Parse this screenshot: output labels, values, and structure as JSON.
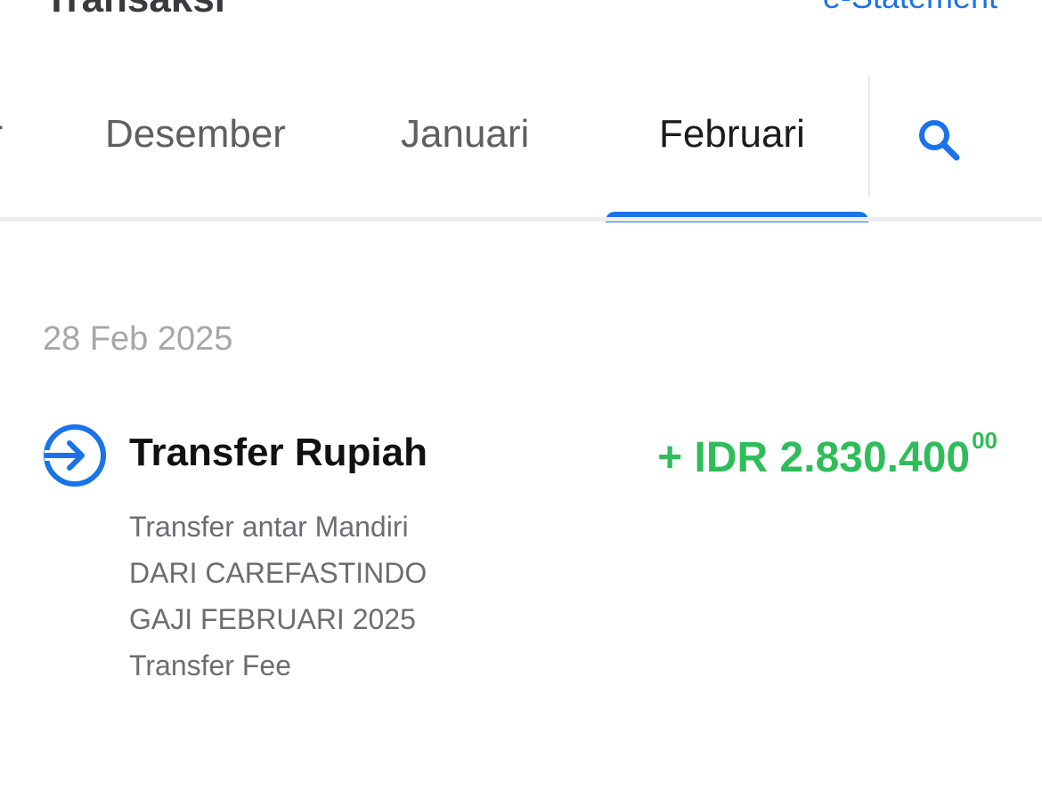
{
  "header": {
    "title": "Transaksi",
    "estatement_label": "e-Statement"
  },
  "tabs": {
    "prev_partial": "er",
    "items": [
      "Desember",
      "Januari",
      "Februari"
    ],
    "active": "Februari"
  },
  "icons": {
    "search": "search-icon",
    "transfer_in": "transfer-in-icon"
  },
  "colors": {
    "accent": "#1a73e8",
    "credit": "#2ebd59"
  },
  "transactions": {
    "date": "28 Feb 2025",
    "items": [
      {
        "title": "Transfer Rupiah",
        "amount_main": "+ IDR 2.830.400",
        "amount_cents": "00",
        "details": [
          "Transfer antar Mandiri",
          "DARI CAREFASTINDO",
          "GAJI FEBRUARI 2025",
          "Transfer Fee"
        ]
      }
    ]
  }
}
